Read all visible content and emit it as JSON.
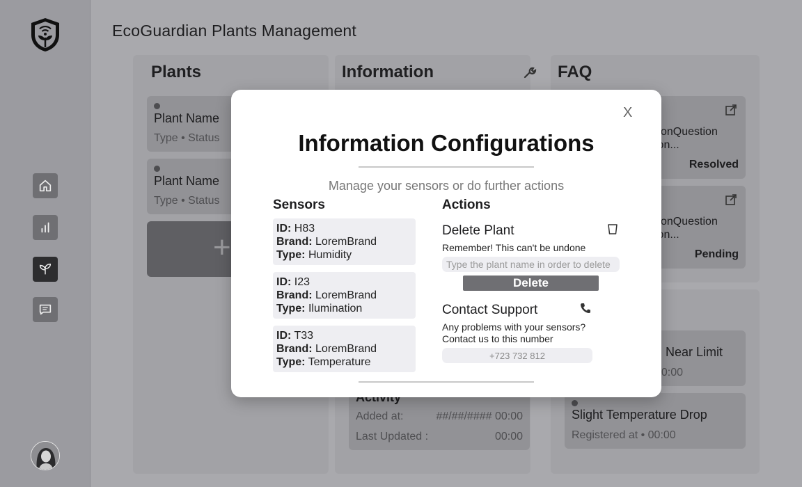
{
  "app": {
    "title": "EcoGuardian Plants Management"
  },
  "sidebar": {
    "items": [
      {
        "name": "home",
        "icon": "home-icon"
      },
      {
        "name": "stats",
        "icon": "bar-chart-icon"
      },
      {
        "name": "plants",
        "icon": "sprout-icon",
        "active": true
      },
      {
        "name": "messages",
        "icon": "chat-icon"
      }
    ]
  },
  "plants_panel": {
    "title": "Plants",
    "items": [
      {
        "name": "Plant Name",
        "meta": "Type  •  Status"
      },
      {
        "name": "Plant Name",
        "meta": "Type  •  Status"
      }
    ],
    "add_label": "+"
  },
  "info_panel": {
    "title": "Information",
    "activity": {
      "title": "Activity",
      "added_label": "Added at:",
      "added_value": "##/##/#### 00:00",
      "updated_label": "Last Updated :",
      "updated_value": "00:00"
    }
  },
  "faq_panel": {
    "title": "FAQ",
    "items": [
      {
        "line1": "tionQuestion",
        "line2": "ion...",
        "status": "Resolved"
      },
      {
        "line1": "tionQuestion",
        "line2": "ion...",
        "status": "Pending"
      }
    ]
  },
  "alerts": {
    "items": [
      {
        "title": "d Near Limit",
        "meta": "00:00"
      },
      {
        "title": "Slight Temperature Drop",
        "meta": "Registered at  •  00:00"
      }
    ]
  },
  "modal": {
    "close_label": "X",
    "title": "Information Configurations",
    "subtitle": "Manage your sensors or do further actions",
    "sensors": {
      "heading": "Sensors",
      "id_label": "ID:",
      "brand_label": "Brand:",
      "type_label": "Type:",
      "list": [
        {
          "id": "H83",
          "brand": "LoremBrand",
          "type": "Humidity"
        },
        {
          "id": "I23",
          "brand": "LoremBrand",
          "type": "Ilumination"
        },
        {
          "id": "T33",
          "brand": "LoremBrand",
          "type": "Temperature"
        }
      ]
    },
    "actions": {
      "heading": "Actions",
      "delete": {
        "title": "Delete Plant",
        "warning": "Remember! This can't be undone",
        "placeholder": "Type the plant name in order to delete",
        "button": "Delete"
      },
      "support": {
        "title": "Contact Support",
        "text_line1": "Any problems with your sensors?",
        "text_line2": "Contact us to this number",
        "phone": "+723 732 812"
      }
    }
  }
}
